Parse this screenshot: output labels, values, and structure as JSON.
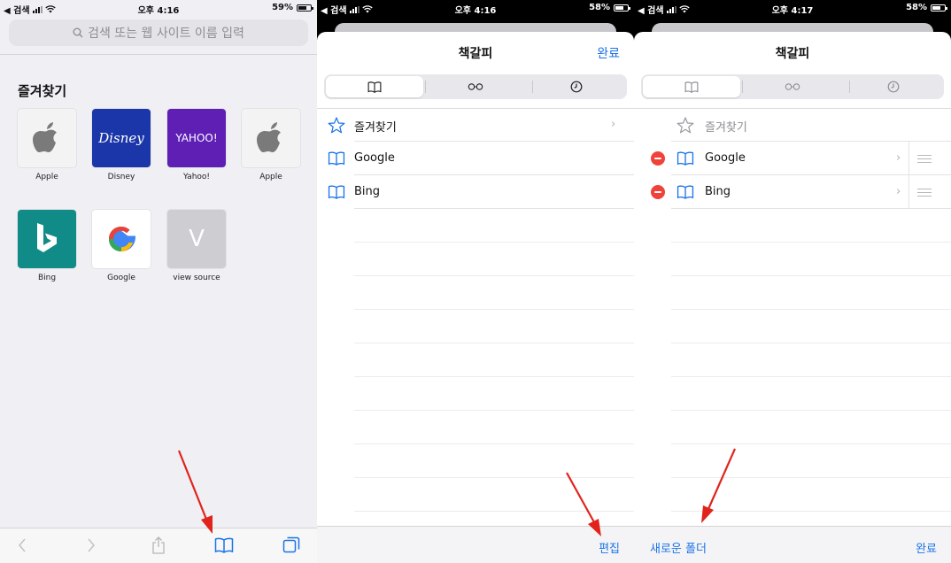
{
  "colors": {
    "accent": "#1a73e8",
    "annotation_arrow": "#e0241c",
    "delete_red": "#f0423a"
  },
  "panel1": {
    "status": {
      "back_label": "◀ 검색",
      "time": "오후 4:16",
      "battery": "59%"
    },
    "search_placeholder": "검색 또는 웹 사이트 이름 입력",
    "favorites_title": "즐겨찾기",
    "tiles": [
      {
        "label": "Apple",
        "icon": "apple-icon"
      },
      {
        "label": "Disney",
        "icon": "disney-logo",
        "logo_text": "Disney"
      },
      {
        "label": "Yahoo!",
        "icon": "yahoo-logo",
        "logo_text": "YAHOO!"
      },
      {
        "label": "Apple",
        "icon": "apple-icon"
      },
      {
        "label": "Bing",
        "icon": "bing-logo"
      },
      {
        "label": "Google",
        "icon": "google-logo"
      },
      {
        "label": "view source",
        "icon": "letter-v-icon",
        "logo_text": "V"
      }
    ],
    "toolbar_icons": [
      "back-icon",
      "forward-icon",
      "share-icon",
      "bookmarks-icon",
      "tabs-icon"
    ]
  },
  "panel2": {
    "status": {
      "back_label": "◀ 검색",
      "time": "오후 4:16",
      "battery": "58%"
    },
    "title": "책갈피",
    "done": "완료",
    "segments": [
      "bookmarks-icon",
      "reading-list-icon",
      "history-icon"
    ],
    "rows": [
      {
        "label": "즐겨찾기",
        "icon": "star-icon",
        "chevron": "›"
      },
      {
        "label": "Google",
        "icon": "book-icon"
      },
      {
        "label": "Bing",
        "icon": "book-icon"
      }
    ],
    "edit": "편집"
  },
  "panel3": {
    "status": {
      "back_label": "◀ 검색",
      "time": "오후 4:17",
      "battery": "58%"
    },
    "title": "책갈피",
    "segments": [
      "bookmarks-icon",
      "reading-list-icon",
      "history-icon"
    ],
    "rows": [
      {
        "label": "즐겨찾기",
        "icon": "star-icon"
      },
      {
        "label": "Google",
        "icon": "book-icon",
        "chevron": "›"
      },
      {
        "label": "Bing",
        "icon": "book-icon",
        "chevron": "›"
      }
    ],
    "new_folder": "새로운 폴더",
    "done": "완료"
  }
}
